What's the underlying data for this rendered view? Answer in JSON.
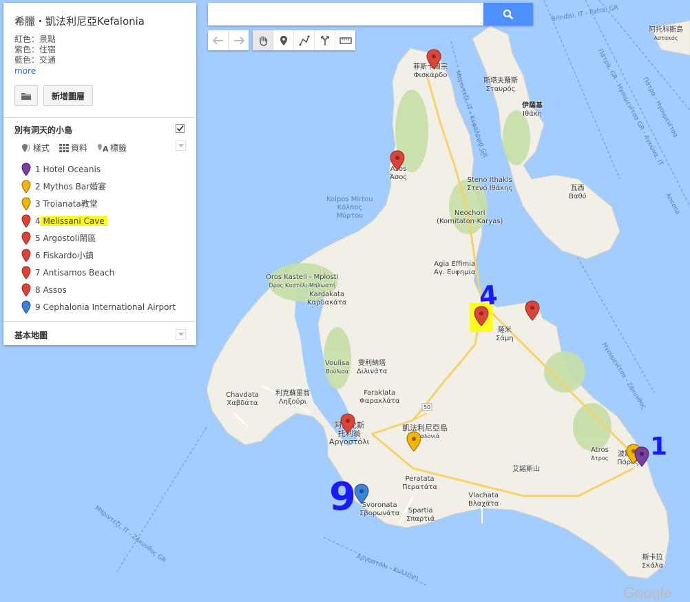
{
  "colors": {
    "water": "#a3ccff",
    "land": "#f2efe6",
    "park": "#c6dfa6",
    "road_yellow": "#f4d36b",
    "pin_red": "#db4437",
    "pin_orange": "#f4b400",
    "pin_purple": "#7b3fa0",
    "pin_blue": "#3b82d8",
    "highlight": "#ffff00",
    "annotation": "#1a1aff",
    "search_button": "#4d90fe"
  },
  "search": {
    "placeholder": "",
    "button_icon": "search-icon"
  },
  "toolbar": {
    "buttons": [
      "undo-icon",
      "redo-icon",
      "hand-icon",
      "marker-icon",
      "line-icon",
      "directions-icon",
      "ruler-icon"
    ],
    "active": "hand-icon"
  },
  "panel": {
    "title": "希臘・凱法利尼亞Kefalonia",
    "desc": [
      "紅色：景點",
      "紫色：住宿",
      "藍色：交通"
    ],
    "more": "more",
    "new_layer": "新增圖層",
    "layer": {
      "title": "別有洞天的小島",
      "checked": true,
      "tools": {
        "style": "樣式",
        "data": "資料",
        "labels": "標籤"
      },
      "items": [
        {
          "n": "1",
          "label": "Hotel Oceanis",
          "color": "purple"
        },
        {
          "n": "2",
          "label": "Mythos Bar婚宴",
          "color": "orange"
        },
        {
          "n": "3",
          "label": "Troianata教堂",
          "color": "orange"
        },
        {
          "n": "4",
          "label": "Melissani Cave",
          "color": "red",
          "highlighted": true
        },
        {
          "n": "5",
          "label": "Argostoli鬧區",
          "color": "red"
        },
        {
          "n": "6",
          "label": "Fiskardo小鎮",
          "color": "red"
        },
        {
          "n": "7",
          "label": "Antisamos Beach",
          "color": "red"
        },
        {
          "n": "8",
          "label": "Assos",
          "color": "red"
        },
        {
          "n": "9",
          "label": "Cephalonia International Airport",
          "color": "blue"
        }
      ]
    },
    "base_map": "基本地圖"
  },
  "map": {
    "places": {
      "fiskardo": [
        "菲斯卡爾宗",
        "Φισκάρδο"
      ],
      "stavros": [
        "斯塔夫羅斯",
        "Σταυρός"
      ],
      "ithaca": [
        "伊薩基",
        "Ιθάκη"
      ],
      "assos": [
        "Asos",
        "Άσος"
      ],
      "steno": [
        "Steno Ithakis",
        "Στενό Ιθάκης"
      ],
      "vathy": [
        "瓦西",
        "Βαθύ"
      ],
      "kolpos": [
        "Kolpos Mirtou",
        "Κόλπος",
        "Μύρτου"
      ],
      "neochori": [
        "Neochori",
        "(Komitaton-Karyas)"
      ],
      "agia_effimia": [
        "Agia Effimia",
        "Αγ. Ευφημία"
      ],
      "oros": [
        "Oros Kasteli - Mplosti",
        "Όρος Καστέλι-Μπλωστή"
      ],
      "kardakata": [
        "Kardakata",
        "Καρδακάτα"
      ],
      "sami": [
        "薩米",
        "Σάμη"
      ],
      "voulisa": [
        "Voulisa",
        "Βούλισα"
      ],
      "dilinata": [
        "雯利納塔",
        "Διλινάτα"
      ],
      "chavdata": [
        "Chavdata",
        "Χαβδάτα"
      ],
      "lixouri": [
        "利克蘇里翁",
        "Ληξούρι"
      ],
      "farakla": [
        "Faraklata",
        "Φαρακλάτα"
      ],
      "argostoli": [
        "阿爾戈斯",
        "托利翁",
        "Αργοστόλι"
      ],
      "kefalonia": [
        "凱法利尼亞島",
        "Κεφαλονιά"
      ],
      "aenos": [
        "艾諾斯山"
      ],
      "atros": [
        "Atros",
        "Άτρος"
      ],
      "poros": [
        "波羅斯",
        "Πόρος"
      ],
      "peratata": [
        "Peratata",
        "Περατάτα"
      ],
      "vlachata": [
        "Vlachata",
        "Βλαχάτα"
      ],
      "svoronata": [
        "Svoronata",
        "Σβορωνάτα"
      ],
      "spartia": [
        "Spartia",
        "Σπαρτιά"
      ],
      "skala": [
        "斯卡拉",
        "Σκάλα"
      ],
      "astakos": [
        "阿托科斯島",
        "Αστακός"
      ]
    },
    "routes": {
      "r1": "Μπριντεζί, IT - Κεφαλονιά GR",
      "r2": "Πάτρα, GR - Ηγουμενίτσα GR - Αγκώνα, IT",
      "r3": "Πάτρα - Ηγουμενίτσα",
      "r4": "Ηγουμενίτσα - Ζάκυνθος",
      "r5": "Μπριντεζί, IT - Ζάκυνθος GR",
      "r6": "Αργοστόλι - Κυλλήνη",
      "r7": "Ancona",
      "r8": "Brindisi, IT - Patra, GR",
      "road": "50"
    },
    "annotations": [
      "4",
      "9",
      "1"
    ],
    "watermark": "Google"
  }
}
